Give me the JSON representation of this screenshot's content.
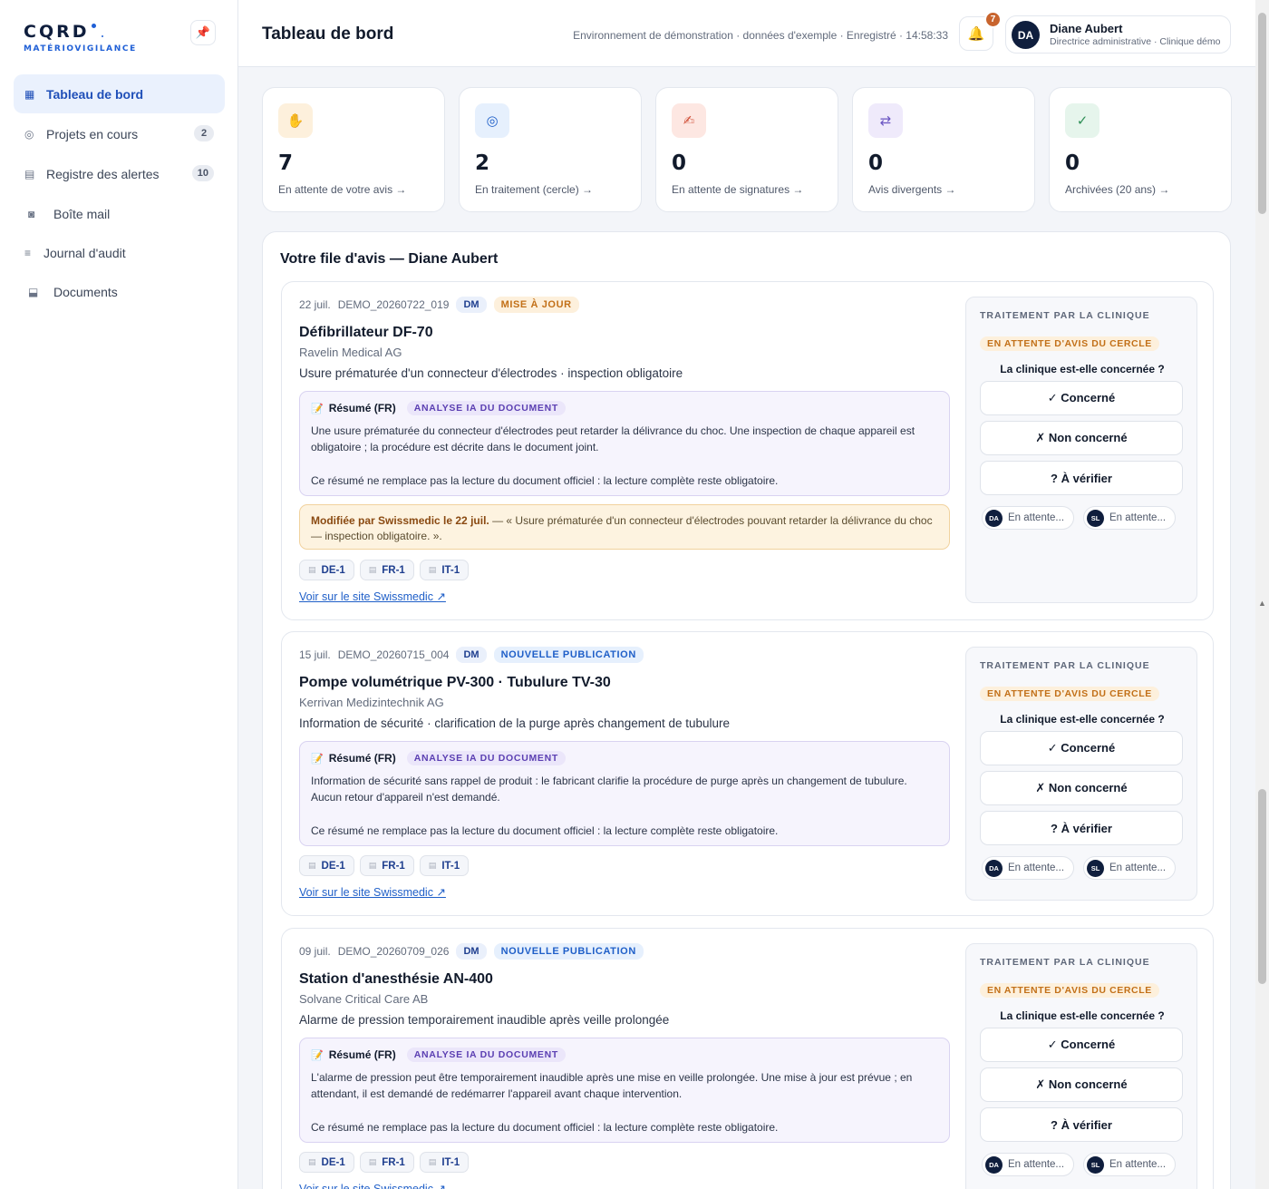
{
  "brand": {
    "name": "CQRD",
    "subtitle": "MATÉRIOVIGILANCE"
  },
  "sidebar": {
    "items": [
      {
        "label": "Tableau de bord",
        "icon": "grid-icon",
        "glyph": "▦",
        "badge": ""
      },
      {
        "label": "Projets en cours",
        "icon": "target-icon",
        "glyph": "◎",
        "badge": "2"
      },
      {
        "label": "Registre des alertes",
        "icon": "list-icon",
        "glyph": "▤",
        "badge": "10"
      },
      {
        "label": "Boîte mail",
        "icon": "mailbox-icon",
        "glyph": "◙",
        "badge": ""
      },
      {
        "label": "Journal d'audit",
        "icon": "log-icon",
        "glyph": "≡",
        "badge": ""
      },
      {
        "label": "Documents",
        "icon": "documents-icon",
        "glyph": "⬓",
        "badge": ""
      }
    ]
  },
  "header": {
    "title": "Tableau de bord",
    "env": "Environnement de démonstration · données d'exemple · Enregistré · 14:58:33",
    "notifications": "7",
    "user": {
      "initials": "DA",
      "name": "Diane Aubert",
      "role": "Directrice administrative · Clinique démo"
    }
  },
  "stats": [
    {
      "value": "7",
      "label": "En attente de votre avis →",
      "icon": "hand-icon",
      "glyph": "✋",
      "bg": "#fdf0dc",
      "color": "#d97b25"
    },
    {
      "value": "2",
      "label": "En traitement (cercle) →",
      "icon": "target-icon",
      "glyph": "◎",
      "bg": "#e6f0fd",
      "color": "#1f5fc8"
    },
    {
      "value": "0",
      "label": "En attente de signatures →",
      "icon": "signature-icon",
      "glyph": "✍",
      "bg": "#fde7e2",
      "color": "#d2553e"
    },
    {
      "value": "0",
      "label": "Avis divergents →",
      "icon": "swap-icon",
      "glyph": "⇄",
      "bg": "#efeafb",
      "color": "#6a55c2"
    },
    {
      "value": "0",
      "label": "Archivées (20 ans) →",
      "icon": "check-icon",
      "glyph": "✓",
      "bg": "#e6f5ec",
      "color": "#2f8f57"
    }
  ],
  "queue": {
    "title": "Votre file d'avis — Diane Aubert",
    "treatment_title": "TRAITEMENT PAR LA CLINIQUE",
    "question": "La clinique est-elle concernée ?",
    "choices": [
      "✓ Concerné",
      "✗ Non concerné",
      "? À vérifier"
    ],
    "reviewers": [
      {
        "initials": "DA",
        "label": "En attente..."
      },
      {
        "initials": "SL",
        "label": "En attente..."
      }
    ],
    "summary_label": "Résumé (FR)",
    "ia_label": "ANALYSE IA DU DOCUMENT",
    "summary_note": "Ce résumé ne remplace pas la lecture du document officiel : la lecture complète reste obligatoire.",
    "link_label": "Voir sur le site Swissmedic ↗",
    "languages": [
      "DE-1",
      "FR-1",
      "IT-1"
    ],
    "alerts": [
      {
        "date": "22 juil.",
        "ref": "DEMO_20260722_019",
        "type": "DM",
        "status": "MISE À JOUR",
        "title": "Défibrillateur DF-70",
        "company": "Ravelin Medical AG",
        "subject": "Usure prématurée d'un connecteur d'électrodes · inspection obligatoire",
        "summary": "Une usure prématurée du connecteur d'électrodes peut retarder la délivrance du choc. Une inspection de chaque appareil est obligatoire ; la procédure est décrite dans le document joint.",
        "modified_label": "Modifiée par Swissmedic le 22 juil.",
        "modified_text": " — « Usure prématurée d'un connecteur d'électrodes pouvant retarder la délivrance du choc — inspection obligatoire. ».",
        "treatment_status": "EN ATTENTE D'AVIS DU CERCLE"
      },
      {
        "date": "15 juil.",
        "ref": "DEMO_20260715_004",
        "type": "DM",
        "status": "NOUVELLE PUBLICATION",
        "title": "Pompe volumétrique PV-300 · Tubulure TV-30",
        "company": "Kerrivan Medizintechnik AG",
        "subject": "Information de sécurité · clarification de la purge après changement de tubulure",
        "summary": "Information de sécurité sans rappel de produit : le fabricant clarifie la procédure de purge après un changement de tubulure. Aucun retour d'appareil n'est demandé.",
        "treatment_status": "EN ATTENTE D'AVIS DU CERCLE"
      },
      {
        "date": "09 juil.",
        "ref": "DEMO_20260709_026",
        "type": "DM",
        "status": "NOUVELLE PUBLICATION",
        "title": "Station d'anesthésie AN-400",
        "company": "Solvane Critical Care AB",
        "subject": "Alarme de pression temporairement inaudible après veille prolongée",
        "summary": "L'alarme de pression peut être temporairement inaudible après une mise en veille prolongée. Une mise à jour est prévue ; en attendant, il est demandé de redémarrer l'appareil avant chaque intervention.",
        "treatment_status": "EN ATTENTE D'AVIS DU CERCLE"
      }
    ]
  }
}
